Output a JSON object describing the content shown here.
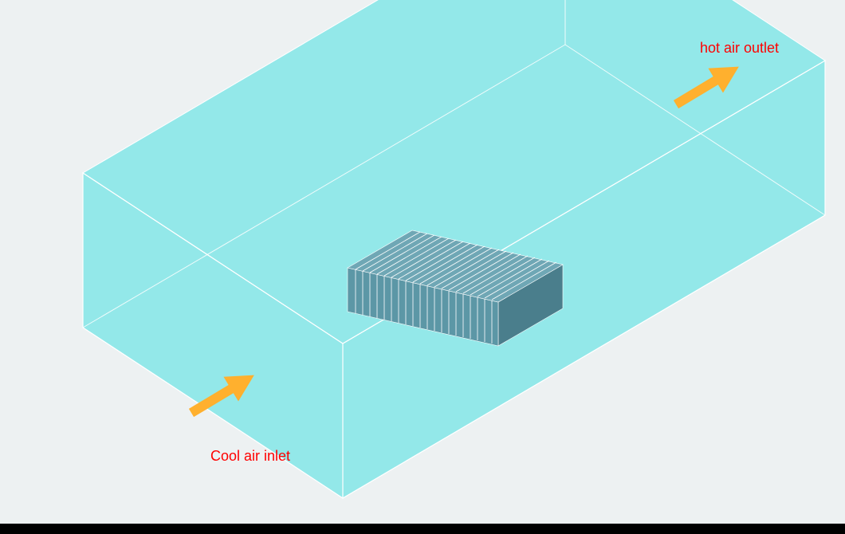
{
  "labels": {
    "inlet": "Cool air inlet",
    "outlet": "hot air outlet"
  },
  "colors": {
    "background": "#EDF1F2",
    "boxFill": "#57E3E3",
    "boxFillOpacity": 0.6,
    "boxEdge": "#FFFFFF",
    "heatsinkFill": "#5C97A6",
    "heatsinkEdge": "#FFFFFF",
    "arrowFill": "#FFB02E",
    "labelText": "#FF0000",
    "bottomBar": "#000000"
  }
}
